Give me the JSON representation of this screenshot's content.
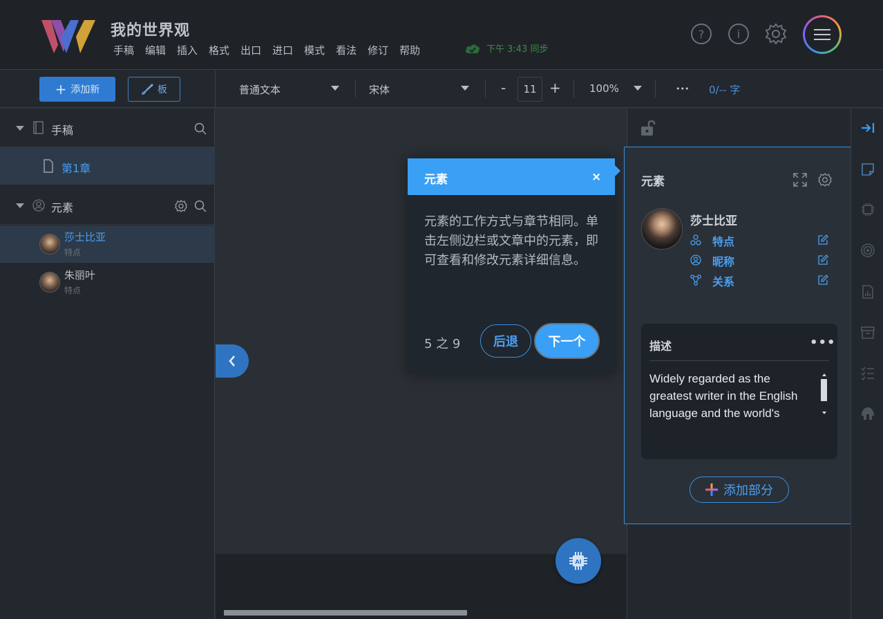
{
  "app": {
    "title": "我的世界观"
  },
  "menu": [
    "手稿",
    "编辑",
    "插入",
    "格式",
    "出口",
    "进口",
    "模式",
    "看法",
    "修订",
    "帮助"
  ],
  "sync": {
    "text": "下午 3:43 同步"
  },
  "toolbar": {
    "add_new": "添加新",
    "board": "板",
    "style": "普通文本",
    "font": "宋体",
    "minus": "-",
    "font_size": "11",
    "plus": "+",
    "zoom": "100%",
    "more": "•••",
    "word_count": "0/-- 字"
  },
  "sidebar": {
    "manuscript": {
      "label": "手稿",
      "chapter": "第1章"
    },
    "elements": {
      "label": "元素",
      "items": [
        {
          "name": "莎士比亚",
          "sub": "特点"
        },
        {
          "name": "朱丽叶",
          "sub": "特点"
        }
      ]
    }
  },
  "tour": {
    "title": "元素",
    "close": "×",
    "body": "元素的工作方式与章节相同。单击左侧边栏或文章中的元素，即可查看和修改元素详细信息。",
    "step": "5 之 9",
    "back": "后退",
    "next": "下一个"
  },
  "element_panel": {
    "title": "元素",
    "name": "莎士比亚",
    "rows": [
      {
        "label": "特点"
      },
      {
        "label": "昵称"
      },
      {
        "label": "关系"
      }
    ],
    "description": {
      "title": "描述",
      "more": "•••",
      "text": "Widely regarded as the greatest writer in the English language and the world's"
    },
    "add_section": "添加部分"
  },
  "colors": {
    "accent": "#3aa0f5",
    "primary": "#2f7bd1",
    "sync": "#3e8a4b"
  }
}
